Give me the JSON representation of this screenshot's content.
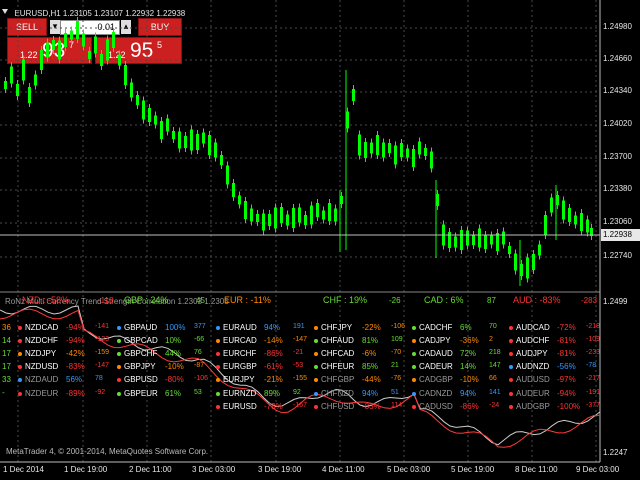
{
  "chart": {
    "title": "EURUSD,H1  1.23105 1.23107 1.22932 1.22938",
    "copyright": "MetaTrader 4, © 2001-2014, MetaQuotes Software Corp.",
    "indicator_name": "RoNz Multi Currency Trend Strength Correlation 1.2303  1.2305",
    "current_price": "1.22938",
    "indicator_scale_top": "1.2499",
    "indicator_scale_bottom": "1.2247",
    "price_ticks": [
      "1.24980",
      "1.24660",
      "1.24340",
      "1.24020",
      "1.23700",
      "1.23380",
      "1.23060",
      "1.22740"
    ],
    "time_ticks": [
      "1 Dec 2014",
      "1 Dec 19:00",
      "2 Dec 11:00",
      "3 Dec 03:00",
      "3 Dec 19:00",
      "4 Dec 11:00",
      "5 Dec 03:00",
      "5 Dec 19:00",
      "8 Dec 11:00",
      "9 Dec 03:00"
    ]
  },
  "trade_panel": {
    "sell_label": "SELL",
    "buy_label": "BUY",
    "lot": "0.01",
    "sell_price_prefix": "1.22",
    "sell_price_big": "93",
    "sell_price_sup": "7",
    "buy_price_prefix": "1.22",
    "buy_price_big": "95",
    "buy_price_sup": "5"
  },
  "strength": [
    {
      "label": "NZD : -58%",
      "value": "-118",
      "color": "#ff3333"
    },
    {
      "label": "GBP : 24%",
      "value": "45",
      "color": "#66dd33"
    },
    {
      "label": "EUR : -11%",
      "value": "",
      "color": "#ff8800"
    },
    {
      "label": "CHF : 19%",
      "value": "-26",
      "color": "#66dd33"
    },
    {
      "label": "CAD : 6%",
      "value": "87",
      "color": "#66dd33"
    },
    {
      "label": "AUD : -83%",
      "value": "-283",
      "color": "#ff3333"
    }
  ],
  "leftcol": [
    "36",
    "14",
    "17",
    "17",
    "33",
    "-"
  ],
  "pairs": [
    [
      {
        "sym": "NZDCAD",
        "pct": "-94%",
        "val": "-141",
        "c": "#ff3333"
      },
      {
        "sym": "NZDCHF",
        "pct": "-94%",
        "val": "-123",
        "c": "#ff3333"
      },
      {
        "sym": "NZDJPY",
        "pct": "-42%",
        "val": "-159",
        "c": "#ff8800"
      },
      {
        "sym": "NZDUSD",
        "pct": "-83%",
        "val": "-147",
        "c": "#ff3333"
      },
      {
        "sym": "NZDAUD",
        "pct": "56%",
        "val": "78",
        "c": "#3399ff"
      },
      {
        "sym": "NZDEUR",
        "pct": "-89%",
        "val": "-92",
        "c": "#ff3333"
      }
    ],
    [
      {
        "sym": "GBPAUD",
        "pct": "100%",
        "val": "377",
        "c": "#3399ff"
      },
      {
        "sym": "GBPCAD",
        "pct": "10%",
        "val": "-66",
        "c": "#66dd33"
      },
      {
        "sym": "GBPCHF",
        "pct": "44%",
        "val": "76",
        "c": "#66dd33"
      },
      {
        "sym": "GBPJPY",
        "pct": "-10%",
        "val": "-87",
        "c": "#ff8800"
      },
      {
        "sym": "GBPUSD",
        "pct": "-80%",
        "val": "-106",
        "c": "#ff3333"
      },
      {
        "sym": "GBPEUR",
        "pct": "61%",
        "val": "53",
        "c": "#66dd33"
      }
    ],
    [
      {
        "sym": "EURAUD",
        "pct": "94%",
        "val": "191",
        "c": "#3399ff"
      },
      {
        "sym": "EURCAD",
        "pct": "-14%",
        "val": "-147",
        "c": "#ff8800"
      },
      {
        "sym": "EURCHF",
        "pct": "-86%",
        "val": "-21",
        "c": "#ff3333"
      },
      {
        "sym": "EURGBP",
        "pct": "-61%",
        "val": "-53",
        "c": "#ff3333"
      },
      {
        "sym": "EURJPY",
        "pct": "-21%",
        "val": "-155",
        "c": "#ff8800"
      },
      {
        "sym": "EURNZD",
        "pct": "89%",
        "val": "92",
        "c": "#66dd33"
      },
      {
        "sym": "EURUSD",
        "pct": "-78%",
        "val": "-167",
        "c": "#ff3333"
      }
    ],
    [
      {
        "sym": "CHFJPY",
        "pct": "-22%",
        "val": "-106",
        "c": "#ff8800"
      },
      {
        "sym": "CHFAUD",
        "pct": "81%",
        "val": "109",
        "c": "#66dd33"
      },
      {
        "sym": "CHFCAD",
        "pct": "-6%",
        "val": "-70",
        "c": "#ff8800"
      },
      {
        "sym": "CHFEUR",
        "pct": "85%",
        "val": "21",
        "c": "#66dd33"
      },
      {
        "sym": "CHFGBP",
        "pct": "-44%",
        "val": "-76",
        "c": "#ff8800"
      },
      {
        "sym": "CHFNZD",
        "pct": "94%",
        "val": "51",
        "c": "#3399ff"
      },
      {
        "sym": "CHFUSD",
        "pct": "-83%",
        "val": "114",
        "c": "#ff3333"
      }
    ],
    [
      {
        "sym": "CADCHF",
        "pct": "6%",
        "val": "70",
        "c": "#66dd33"
      },
      {
        "sym": "CADJPY",
        "pct": "-36%",
        "val": "2",
        "c": "#ff8800"
      },
      {
        "sym": "CADAUD",
        "pct": "72%",
        "val": "218",
        "c": "#66dd33"
      },
      {
        "sym": "CADEUR",
        "pct": "14%",
        "val": "147",
        "c": "#66dd33"
      },
      {
        "sym": "CADGBP",
        "pct": "-10%",
        "val": "66",
        "c": "#ff8800"
      },
      {
        "sym": "CADNZD",
        "pct": "94%",
        "val": "141",
        "c": "#3399ff"
      },
      {
        "sym": "CADUSD",
        "pct": "-86%",
        "val": "-24",
        "c": "#ff3333"
      }
    ],
    [
      {
        "sym": "AUDCAD",
        "pct": "-72%",
        "val": "-218",
        "c": "#ff3333"
      },
      {
        "sym": "AUDCHF",
        "pct": "-81%",
        "val": "-109",
        "c": "#ff3333"
      },
      {
        "sym": "AUDJPY",
        "pct": "-81%",
        "val": "-233",
        "c": "#ff3333"
      },
      {
        "sym": "AUDNZD",
        "pct": "-56%",
        "val": "-78",
        "c": "#3399ff"
      },
      {
        "sym": "AUDUSD",
        "pct": "-97%",
        "val": "-217",
        "c": "#ff3333"
      },
      {
        "sym": "AUDEUR",
        "pct": "-94%",
        "val": "-191",
        "c": "#ff3333"
      },
      {
        "sym": "AUDGBP",
        "pct": "-100%",
        "val": "-377",
        "c": "#ff3333"
      }
    ]
  ],
  "colors": {
    "background": "#000000",
    "candle_bull": "#00ff00",
    "grid": "#4a4a4a",
    "sell_red": "#cc1f1f",
    "indicator_white": "#cccccc",
    "indicator_red": "#ff3b3b"
  }
}
